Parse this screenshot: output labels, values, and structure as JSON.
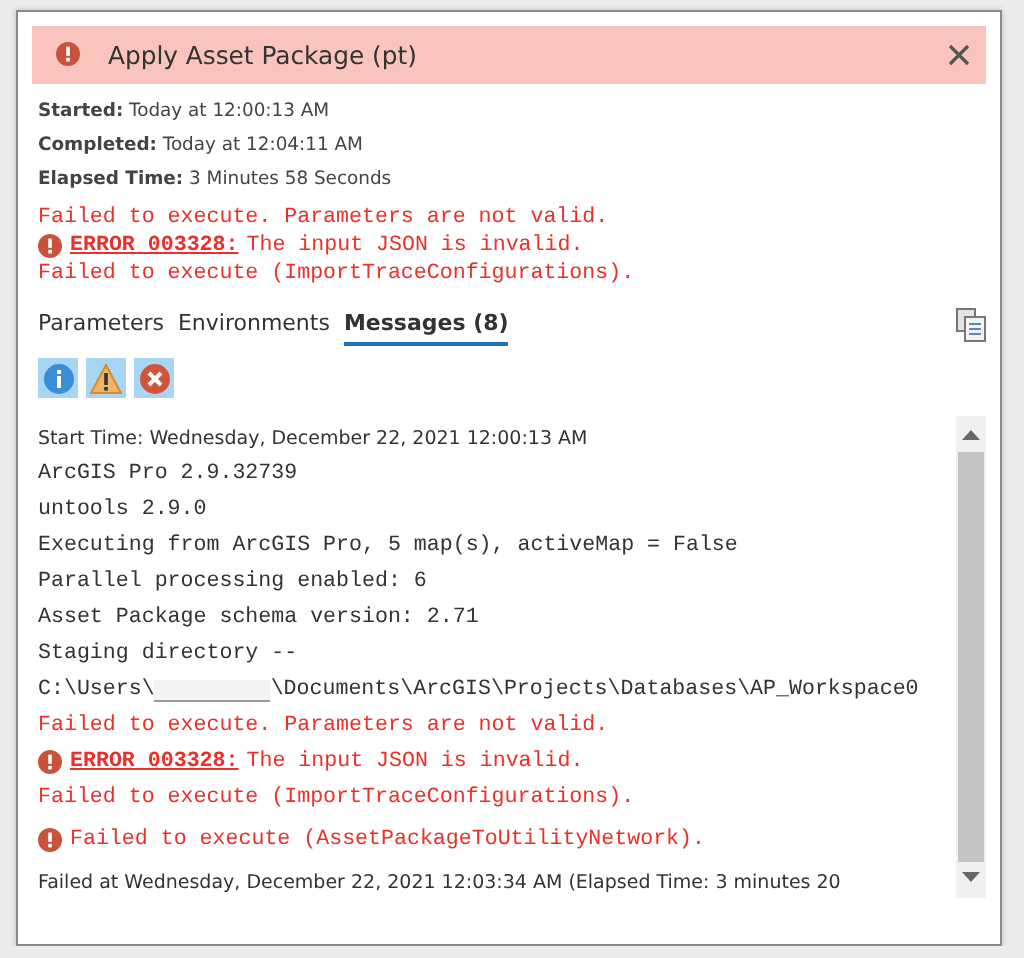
{
  "header": {
    "title": "Apply Asset Package (pt)"
  },
  "summary": [
    {
      "label": "Started:",
      "value": "Today at 12:00:13 AM"
    },
    {
      "label": "Completed:",
      "value": "Today at 12:04:11 AM"
    },
    {
      "label": "Elapsed Time:",
      "value": "3 Minutes 58 Seconds"
    }
  ],
  "errors": [
    {
      "kind": "text",
      "text": "Failed to execute. Parameters are not valid."
    },
    {
      "kind": "coded",
      "code": "ERROR 003328:",
      "text": "The input JSON is invalid."
    },
    {
      "kind": "text",
      "text": "Failed to execute (ImportTraceConfigurations)."
    }
  ],
  "tabs": [
    {
      "label": "Parameters",
      "selected": false
    },
    {
      "label": "Environments",
      "selected": false
    },
    {
      "label": "Messages (8)",
      "selected": true
    }
  ],
  "filters": [
    {
      "kind": "info",
      "selected": true
    },
    {
      "kind": "warning",
      "selected": true
    },
    {
      "kind": "error",
      "selected": true
    }
  ],
  "messages": [
    {
      "kind": "info",
      "text": "Start Time: Wednesday, December 22, 2021 12:00:13 AM"
    },
    {
      "kind": "mono",
      "text": "ArcGIS Pro 2.9.32739"
    },
    {
      "kind": "mono",
      "text": "untools 2.9.0"
    },
    {
      "kind": "mono",
      "text": "Executing from ArcGIS Pro, 5 map(s), activeMap = False"
    },
    {
      "kind": "mono",
      "text": "Parallel processing enabled: 6"
    },
    {
      "kind": "mono",
      "text": "Asset Package schema version: 2.71"
    },
    {
      "kind": "mono",
      "text": "Staging directory --"
    },
    {
      "kind": "path",
      "text": "C:\\Users\\",
      "rest": "\\Documents\\ArcGIS\\Projects\\Databases\\AP_Workspace0"
    },
    {
      "kind": "error",
      "text": "Failed to execute. Parameters are not valid."
    },
    {
      "kind": "coded",
      "code": "ERROR 003328:",
      "text": "The input JSON is invalid."
    },
    {
      "kind": "error",
      "text": "Failed to execute (ImportTraceConfigurations)."
    },
    {
      "kind": "error-icon",
      "text": "Failed to execute (AssetPackageToUtilityNetwork)."
    },
    {
      "kind": "info",
      "text": "Failed at Wednesday, December 22, 2021 12:03:34 AM (Elapsed Time: 3 minutes 20"
    }
  ]
}
